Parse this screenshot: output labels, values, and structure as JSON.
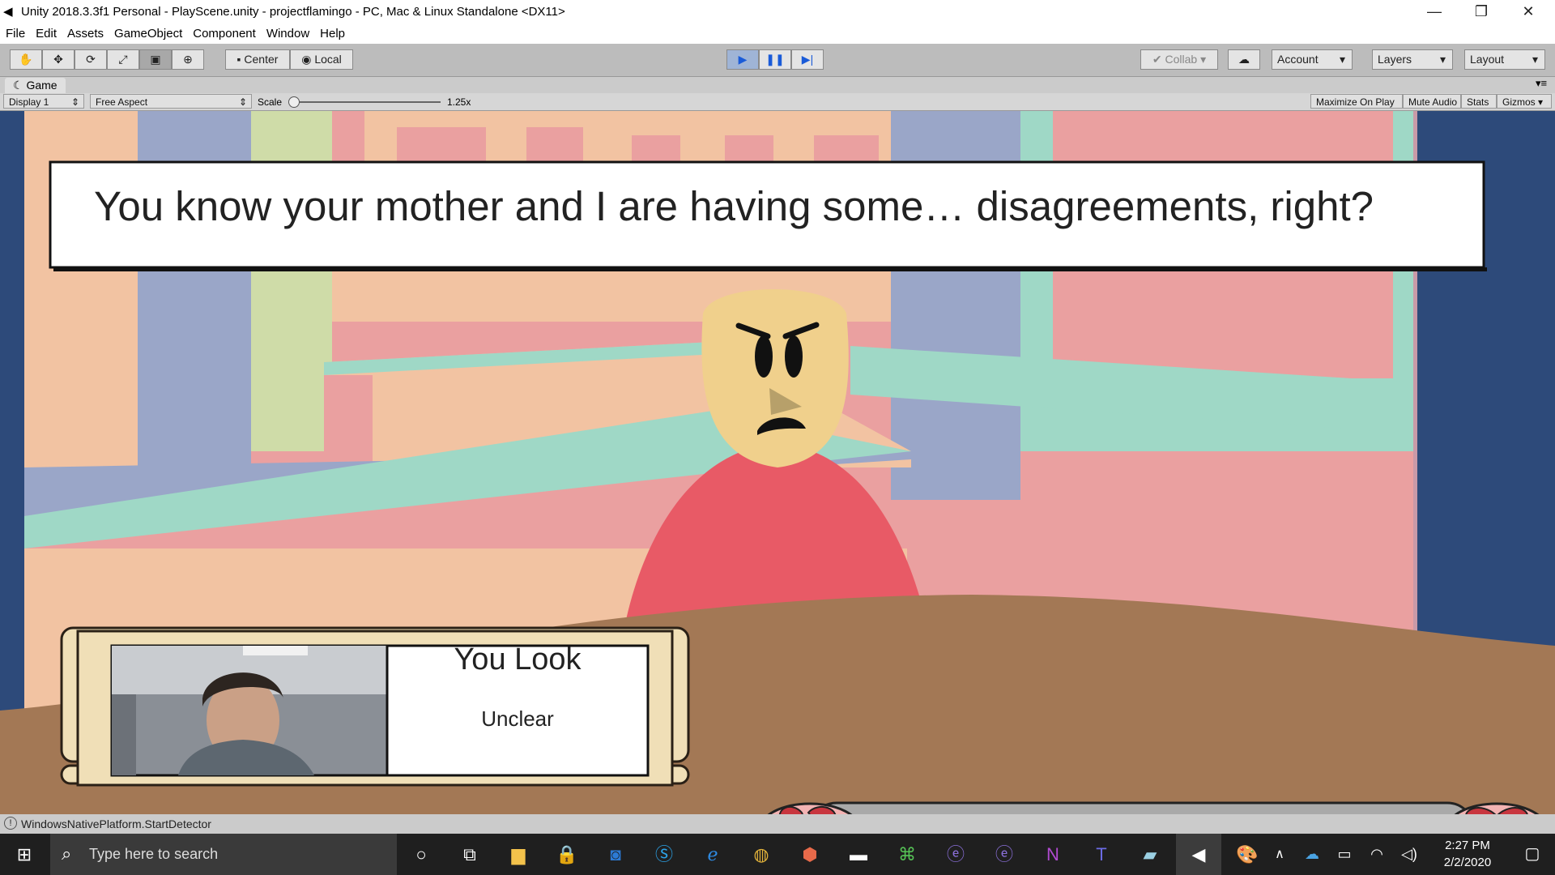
{
  "window": {
    "title": "Unity 2018.3.3f1 Personal - PlayScene.unity - projectflamingo - PC, Mac & Linux Standalone <DX11>",
    "controls": [
      "—",
      "❐",
      "✕"
    ]
  },
  "menu": [
    "File",
    "Edit",
    "Assets",
    "GameObject",
    "Component",
    "Window",
    "Help"
  ],
  "toolbar": {
    "pivot": "Center",
    "space": "Local",
    "collab": "Collab",
    "account": "Account",
    "layers": "Layers",
    "layout": "Layout"
  },
  "game_tab": {
    "label": "Game"
  },
  "game_bar": {
    "display": "Display 1",
    "aspect": "Free Aspect",
    "scale_label": "Scale",
    "scale_value": "1.25x",
    "maximize": "Maximize On Play",
    "mute": "Mute Audio",
    "stats": "Stats",
    "gizmos": "Gizmos"
  },
  "game": {
    "dialog": "You know your mother and I are having some… disagreements, right?",
    "status_title": "You Look",
    "status_value": "Unclear",
    "meter_segments": 5,
    "colors": {
      "wall_pink": "#eaa0a0",
      "wall_green": "#9fd8c6",
      "wall_blue": "#9aa6c8",
      "shirt": "#e85a66",
      "table": "#a37855",
      "face": "#f0d08c"
    }
  },
  "status": {
    "message": "WindowsNativePlatform.StartDetector"
  },
  "taskbar": {
    "search_placeholder": "Type here to search",
    "time": "2:27 PM",
    "date": "2/2/2020"
  }
}
